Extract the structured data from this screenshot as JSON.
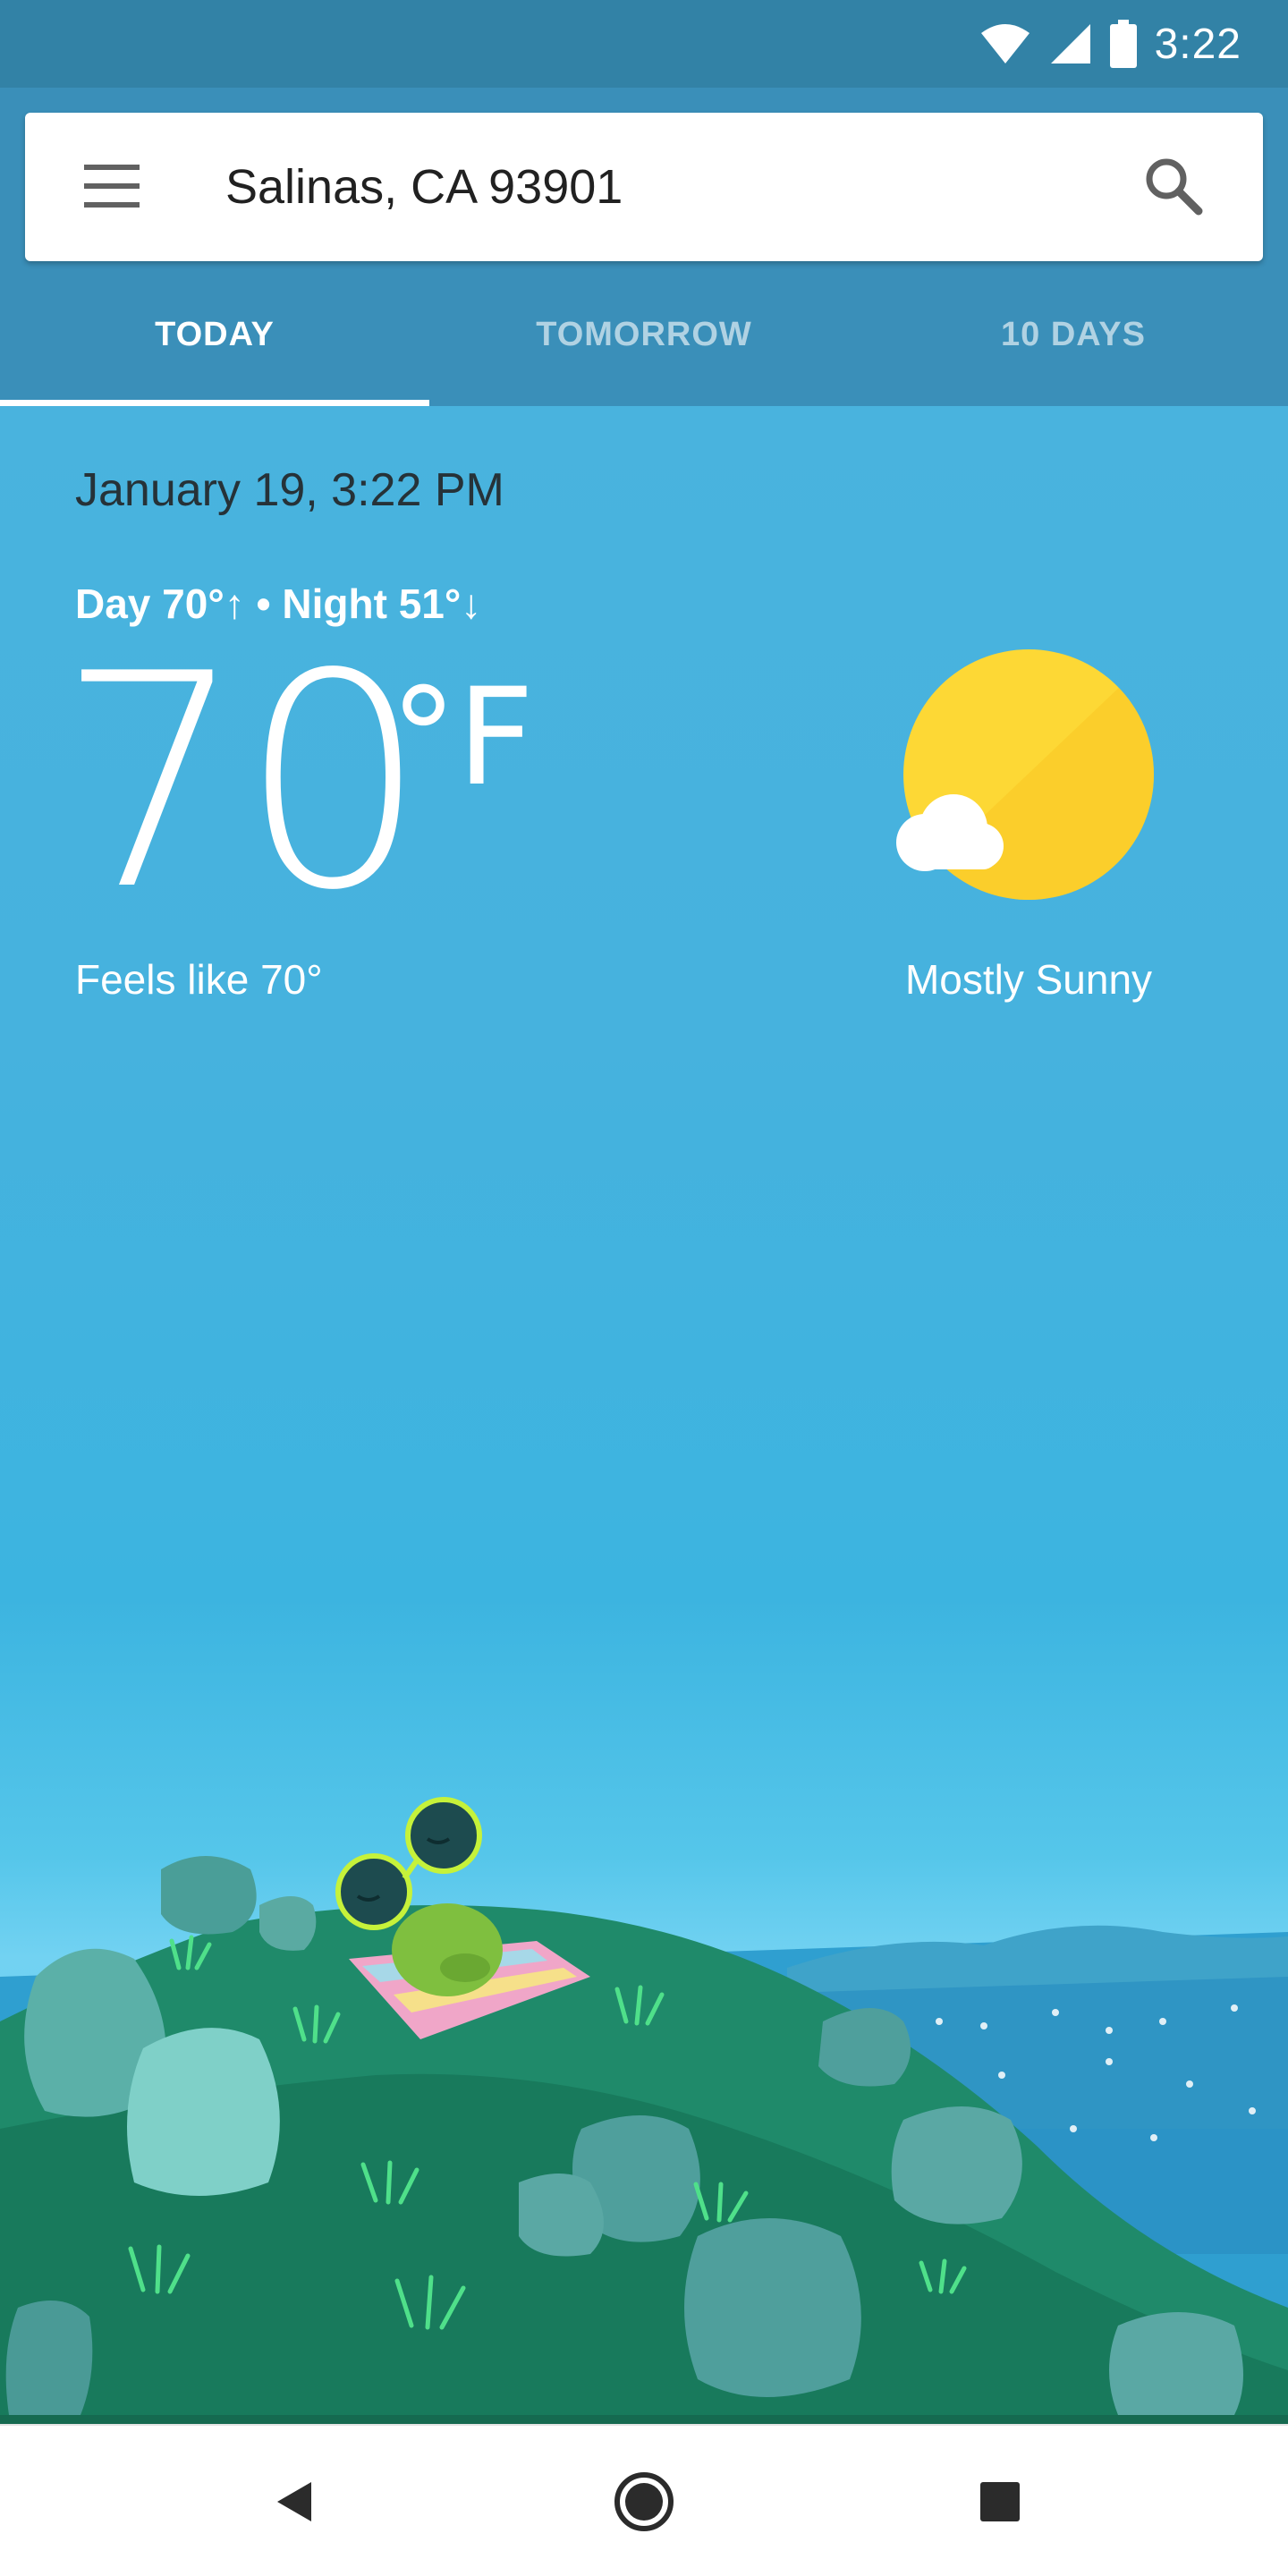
{
  "status_bar": {
    "time": "3:22",
    "icons": [
      "wifi-icon",
      "cell-signal-icon",
      "battery-icon"
    ]
  },
  "search": {
    "location": "Salinas, CA 93901",
    "menu_icon": "menu-icon",
    "search_icon": "search-icon"
  },
  "tabs": [
    {
      "label": "TODAY",
      "active": true
    },
    {
      "label": "TOMORROW",
      "active": false
    },
    {
      "label": "10 DAYS",
      "active": false
    }
  ],
  "weather": {
    "datetime": "January 19, 3:22 PM",
    "day_night": "Day 70°↑ • Night 51°↓",
    "temperature": "70",
    "unit": "°F",
    "feels_like": "Feels like 70°",
    "condition": "Mostly Sunny",
    "condition_icon": "mostly-sunny-icon"
  },
  "nav": {
    "back_icon": "back-icon",
    "home_icon": "home-icon",
    "recents_icon": "recents-icon"
  },
  "colors": {
    "status_bar": "#3282a6",
    "header": "#3a8fb9",
    "sky": "#46b2de",
    "sun": "#fdd835",
    "hill": "#1f8a6a"
  }
}
